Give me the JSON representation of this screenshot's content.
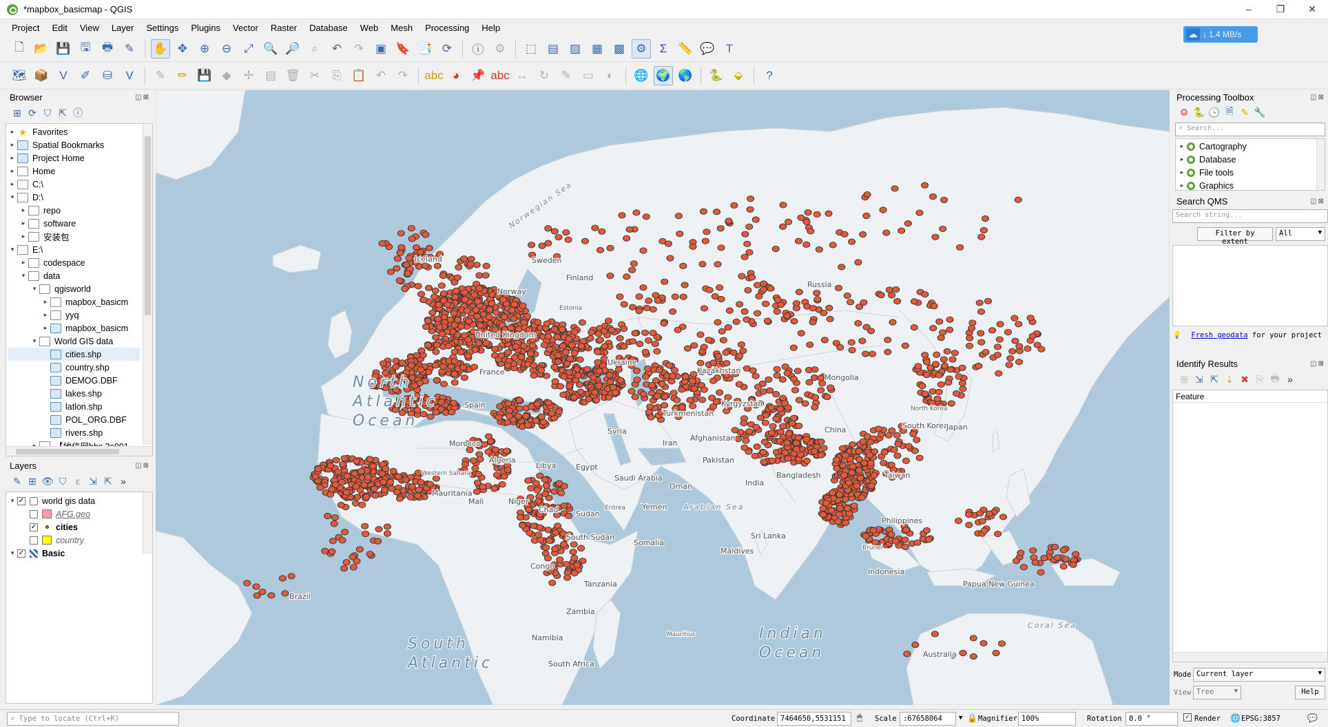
{
  "window": {
    "title": "*mapbox_basicmap - QGIS"
  },
  "menu": [
    "Project",
    "Edit",
    "View",
    "Layer",
    "Settings",
    "Plugins",
    "Vector",
    "Raster",
    "Database",
    "Web",
    "Mesh",
    "Processing",
    "Help"
  ],
  "speed_widget": {
    "text": "1.4 MB/s",
    "arrow": "↓"
  },
  "browser": {
    "title": "Browser",
    "items": [
      {
        "label": "Favorites",
        "depth": 0,
        "icon": "star-icon",
        "expander": "▸"
      },
      {
        "label": "Spatial Bookmarks",
        "depth": 0,
        "icon": "bookmark-icon",
        "expander": "▸"
      },
      {
        "label": "Project Home",
        "depth": 0,
        "icon": "project-home-icon",
        "expander": "▸"
      },
      {
        "label": "Home",
        "depth": 0,
        "icon": "home-folder-icon",
        "expander": "▸"
      },
      {
        "label": "C:\\",
        "depth": 0,
        "icon": "drive-icon",
        "expander": "▸"
      },
      {
        "label": "D:\\",
        "depth": 0,
        "icon": "drive-icon",
        "expander": "▾"
      },
      {
        "label": "repo",
        "depth": 1,
        "icon": "folder-icon",
        "expander": "▸"
      },
      {
        "label": "software",
        "depth": 1,
        "icon": "folder-icon",
        "expander": "▸"
      },
      {
        "label": "安装包",
        "depth": 1,
        "icon": "folder-icon",
        "expander": "▸"
      },
      {
        "label": "E:\\",
        "depth": 0,
        "icon": "drive-icon",
        "expander": "▾"
      },
      {
        "label": "codespace",
        "depth": 1,
        "icon": "folder-icon",
        "expander": "▸"
      },
      {
        "label": "data",
        "depth": 1,
        "icon": "folder-icon",
        "expander": "▾"
      },
      {
        "label": "qgisworld",
        "depth": 2,
        "icon": "folder-icon",
        "expander": "▾"
      },
      {
        "label": "mapbox_basicm",
        "depth": 3,
        "icon": "folder-icon",
        "expander": "▸"
      },
      {
        "label": "yyq",
        "depth": 3,
        "icon": "folder-icon",
        "expander": "▸"
      },
      {
        "label": "mapbox_basicm",
        "depth": 3,
        "icon": "qgis-project-icon",
        "expander": "▸"
      },
      {
        "label": "World GIS data",
        "depth": 2,
        "icon": "folder-icon",
        "expander": "▾"
      },
      {
        "label": "cities.shp",
        "depth": 3,
        "icon": "shapefile-icon",
        "expander": "",
        "selected": true
      },
      {
        "label": "country.shp",
        "depth": 3,
        "icon": "shapefile-icon",
        "expander": ""
      },
      {
        "label": "DEMOG.DBF",
        "depth": 3,
        "icon": "table-icon",
        "expander": ""
      },
      {
        "label": "lakes.shp",
        "depth": 3,
        "icon": "shapefile-icon",
        "expander": ""
      },
      {
        "label": "latlon.shp",
        "depth": 3,
        "icon": "shapefile-icon",
        "expander": ""
      },
      {
        "label": "POL_ORG.DBF",
        "depth": 3,
        "icon": "table-icon",
        "expander": ""
      },
      {
        "label": "rivers.shp",
        "depth": 3,
        "icon": "shapefile-icon",
        "expander": ""
      },
      {
        "label": "【地信网bbs.3s001",
        "depth": 2,
        "icon": "folder-icon",
        "expander": "▸"
      }
    ]
  },
  "layers": {
    "title": "Layers",
    "items": [
      {
        "label": "world gis data",
        "depth": 0,
        "checked": true,
        "icon": "group-icon",
        "style": "normal",
        "expander": "▾"
      },
      {
        "label": "AFG.geo",
        "depth": 1,
        "checked": false,
        "icon": "polygon-swatch-icon",
        "swatch": "#f4a0a8",
        "style": "italic-underline",
        "expander": ""
      },
      {
        "label": "cities",
        "depth": 1,
        "checked": true,
        "icon": "point-swatch-icon",
        "swatch": "#e0603a",
        "style": "bold",
        "expander": ""
      },
      {
        "label": "country",
        "depth": 1,
        "checked": false,
        "icon": "polygon-swatch-icon",
        "swatch": "#ffff00",
        "style": "italic",
        "expander": ""
      },
      {
        "label": "Basic",
        "depth": 0,
        "checked": true,
        "icon": "tile-layer-icon",
        "style": "bold",
        "expander": "▾"
      }
    ]
  },
  "map": {
    "point_color": "#e05a3c",
    "ocean_color": "#aec9db",
    "land_color": "#eef1f3",
    "labels": [
      {
        "text": "Norwegian Sea",
        "style": "water"
      },
      {
        "text": "Iceland",
        "style": "country"
      },
      {
        "text": "Sweden",
        "style": "country"
      },
      {
        "text": "Finland",
        "style": "country"
      },
      {
        "text": "Norway",
        "style": "country"
      },
      {
        "text": "Estonia",
        "style": "small"
      },
      {
        "text": "United Kingdom",
        "style": "country"
      },
      {
        "text": "France",
        "style": "country"
      },
      {
        "text": "Spain",
        "style": "country"
      },
      {
        "text": "Morocco",
        "style": "country"
      },
      {
        "text": "Algeria",
        "style": "country"
      },
      {
        "text": "Libya",
        "style": "country"
      },
      {
        "text": "Egypt",
        "style": "country"
      },
      {
        "text": "Western Sahara",
        "style": "small"
      },
      {
        "text": "Mauritania",
        "style": "country"
      },
      {
        "text": "Mali",
        "style": "country"
      },
      {
        "text": "Niger",
        "style": "country"
      },
      {
        "text": "Chad",
        "style": "country"
      },
      {
        "text": "Sudan",
        "style": "country"
      },
      {
        "text": "South Sudan",
        "style": "country"
      },
      {
        "text": "Eritrea",
        "style": "small"
      },
      {
        "text": "Yemen",
        "style": "country"
      },
      {
        "text": "Somalia",
        "style": "country"
      },
      {
        "text": "Saudi Arabia",
        "style": "country"
      },
      {
        "text": "Oman",
        "style": "country"
      },
      {
        "text": "Syria",
        "style": "country"
      },
      {
        "text": "Iran",
        "style": "country"
      },
      {
        "text": "Afghanistan",
        "style": "country"
      },
      {
        "text": "Pakistan",
        "style": "country"
      },
      {
        "text": "Turkmenistan",
        "style": "country"
      },
      {
        "text": "Kyrgyzstan",
        "style": "country"
      },
      {
        "text": "Kazakhstan",
        "style": "country"
      },
      {
        "text": "Mongolia",
        "style": "country"
      },
      {
        "text": "Russia",
        "style": "country"
      },
      {
        "text": "China",
        "style": "country"
      },
      {
        "text": "India",
        "style": "country"
      },
      {
        "text": "Bangladesh",
        "style": "country"
      },
      {
        "text": "Sri Lanka",
        "style": "country"
      },
      {
        "text": "Maldives",
        "style": "country"
      },
      {
        "text": "Philippines",
        "style": "country"
      },
      {
        "text": "Taiwan",
        "style": "country"
      },
      {
        "text": "South Korea",
        "style": "country"
      },
      {
        "text": "North Korea",
        "style": "small"
      },
      {
        "text": "Japan",
        "style": "country"
      },
      {
        "text": "Brunei",
        "style": "small"
      },
      {
        "text": "Indonesia",
        "style": "country"
      },
      {
        "text": "Papua New Guinea",
        "style": "country"
      },
      {
        "text": "Australia",
        "style": "country"
      },
      {
        "text": "Tanzania",
        "style": "country"
      },
      {
        "text": "Congo",
        "style": "country"
      },
      {
        "text": "Zambia",
        "style": "country"
      },
      {
        "text": "Namibia",
        "style": "country"
      },
      {
        "text": "South Africa",
        "style": "country"
      },
      {
        "text": "Mauritius",
        "style": "small"
      },
      {
        "text": "Brazil",
        "style": "country"
      },
      {
        "text": "Ukraine",
        "style": "country"
      },
      {
        "text": "North Atlantic Ocean",
        "style": "ocean"
      },
      {
        "text": "South Atlantic",
        "style": "ocean"
      },
      {
        "text": "Indian Ocean",
        "style": "ocean"
      },
      {
        "text": "Arabian Sea",
        "style": "water"
      },
      {
        "text": "Coral Sea",
        "style": "water"
      }
    ]
  },
  "processing": {
    "title": "Processing Toolbox",
    "search_placeholder": "Search...",
    "items": [
      "Cartography",
      "Database",
      "File tools",
      "Graphics"
    ]
  },
  "qms": {
    "title": "Search QMS",
    "search_placeholder": "Search string...",
    "filter_button": "Filter by extent",
    "filter_select": "All",
    "notice_link": "Fresh geodata",
    "notice_text": " for your project"
  },
  "identify": {
    "title": "Identify Results",
    "column": "Feature",
    "mode_label": "Mode",
    "mode_value": "Current layer",
    "view_label": "View",
    "view_value": "Tree",
    "help": "Help"
  },
  "status": {
    "locate_placeholder": "Type to locate (Ctrl+K)",
    "coordinate_label": "Coordinate",
    "coordinate_value": "7464650,5531151",
    "scale_label": "Scale",
    "scale_value": ":67658064",
    "magnifier_label": "Magnifier",
    "magnifier_value": "100%",
    "rotation_label": "Rotation",
    "rotation_value": "0.0 °",
    "render_label": "Render",
    "crs": "EPSG:3857"
  }
}
